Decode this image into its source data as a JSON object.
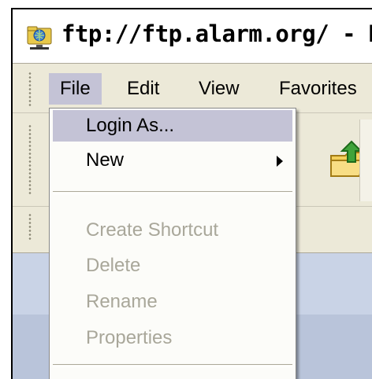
{
  "window": {
    "title": "ftp://ftp.alarm.org/ - Mi",
    "icon": "network-folder-icon"
  },
  "menubar": {
    "items": [
      {
        "label": "File",
        "active": true
      },
      {
        "label": "Edit"
      },
      {
        "label": "View"
      },
      {
        "label": "Favorites"
      }
    ]
  },
  "file_menu": {
    "items": [
      {
        "label": "Login As...",
        "highlighted": true,
        "enabled": true
      },
      {
        "label": "New",
        "submenu": true,
        "enabled": true
      },
      {
        "label": "Create Shortcut",
        "enabled": false
      },
      {
        "label": "Delete",
        "enabled": false
      },
      {
        "label": "Rename",
        "enabled": false
      },
      {
        "label": "Properties",
        "enabled": false
      }
    ]
  },
  "toolbar": {
    "up_icon": "up-folder-icon"
  },
  "colors": {
    "highlight": "#c4c3d6",
    "disabled_text": "#a9a79a",
    "menu_bg": "#ece9d8",
    "content_bg": "#c9d3e6"
  }
}
